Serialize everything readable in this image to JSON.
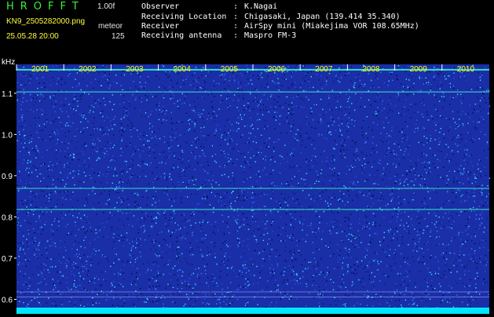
{
  "header": {
    "app_title": "HROFFT",
    "version": "1.00f",
    "filename": "KN9_2505282000.png",
    "datetime": "25.05.28 20:00",
    "meteor_label": "meteor",
    "meteor_count": "125"
  },
  "station_info": [
    {
      "label": "Observer",
      "sep": ":",
      "value": "K.Nagai"
    },
    {
      "label": "Receiving Location",
      "sep": ":",
      "value": "Chigasaki, Japan (139.414 35.340)"
    },
    {
      "label": "Receiver",
      "sep": ":",
      "value": "AirSpy mini (Miakejima VOR 108.65MHz)"
    },
    {
      "label": "Receiving antenna",
      "sep": ":",
      "value": "Maspro FM-3"
    }
  ],
  "chart_data": {
    "type": "heatmap",
    "ylabel": "kHz",
    "y_ticks": [
      "1.1",
      "1.0",
      "0.9",
      "0.8",
      "0.7",
      "0.6"
    ],
    "y_tick_values": [
      1.1,
      1.0,
      0.9,
      0.8,
      0.7,
      0.6
    ],
    "ylim": [
      0.58,
      1.17
    ],
    "x_ticks": [
      "2001",
      "2002",
      "2003",
      "2004",
      "2005",
      "2006",
      "2007",
      "2008",
      "2009",
      "2010"
    ],
    "horizontal_lines_khz": [
      1.157,
      1.103,
      0.869,
      0.818
    ],
    "colors": {
      "background": "#1a2ea8",
      "noise_light": "#3f7fff",
      "noise_cyan": "#3ce1ff",
      "line_bright": "#3cf0c8",
      "tick_label": "#ffff00",
      "axis_text": "#ffffff",
      "bottom_bar": "#00e6ff"
    }
  }
}
